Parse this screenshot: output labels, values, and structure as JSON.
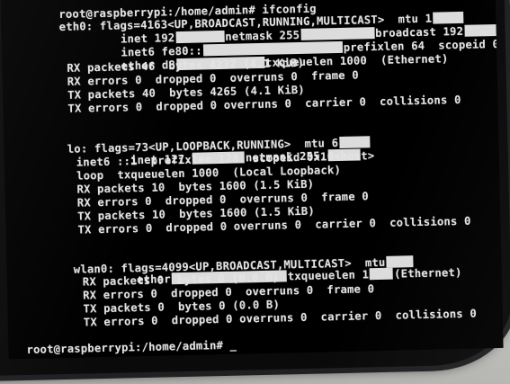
{
  "terminal": {
    "prompt_command": "root@raspberrypi:/home/admin# ifconfig",
    "eth0": {
      "flags": "eth0: flags=4163<UP,BROADCAST,RUNNING,MULTICAST>  mtu 1",
      "inet_a": "inet 192",
      "inet_b": "netmask 255",
      "inet_c": "broadcast 192",
      "inet6_a": "inet6 fe80::",
      "inet6_b": "prefixlen 64  scopeid 0x20<link>",
      "ether_a": "ether d8",
      "ether_b": "txqueuelen 1000  (Ethernet)",
      "rx_packets": "RX packets 46  bytes 4232 (4.1 KiB)",
      "rx_errors": "RX errors 0  dropped 0  overruns 0  frame 0",
      "tx_packets": "TX packets 40  bytes 4265 (4.1 KiB)",
      "tx_errors": "TX errors 0  dropped 0 overruns 0  carrier 0  collisions 0"
    },
    "lo": {
      "flags": "lo: flags=73<UP,LOOPBACK,RUNNING>  mtu 6",
      "inet_a": "inet 127.",
      "inet_b": "netmask 255.",
      "inet6": "inet6 ::1  prefixlen 128  scopeid 0x10<host>",
      "loop": "loop  txqueuelen 1000  (Local Loopback)",
      "rx_packets": "RX packets 10  bytes 1600 (1.5 KiB)",
      "rx_errors": "RX errors 0  dropped 0  overruns 0  frame 0",
      "tx_packets": "TX packets 10  bytes 1600 (1.5 KiB)",
      "tx_errors": "TX errors 0  dropped 0 overruns 0  carrier 0  collisions 0"
    },
    "wlan0": {
      "flags": "wlan0: flags=4099<UP,BROADCAST,MULTICAST>  mtu",
      "ether_a": "ether",
      "ether_b": "txqueuelen 1",
      "ether_c": "(Ethernet)",
      "rx_packets": "RX packets 0  bytes 0 (0.0 B)",
      "rx_errors": "RX errors 0  dropped 0  overruns 0  frame 0",
      "tx_packets": "TX packets 0  bytes 0 (0.0 B)",
      "tx_errors": "TX errors 0  dropped 0 overruns 0  carrier 0  collisions 0"
    },
    "final_prompt": "root@raspberrypi:/home/admin# _"
  },
  "colors": {
    "text": "#e3e3e3",
    "redaction": "#dcdcdc",
    "screen": "#000000"
  }
}
